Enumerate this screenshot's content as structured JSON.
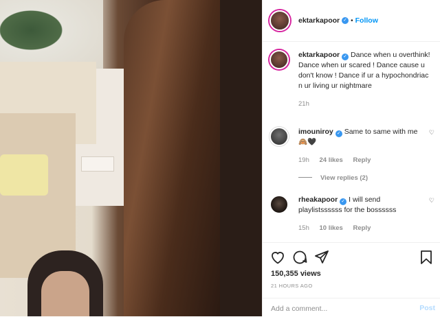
{
  "header": {
    "username": "ektarkapoor",
    "separator": "•",
    "follow_label": "Follow"
  },
  "caption": {
    "username": "ektarkapoor",
    "text": "Dance when u overthink! Dance when ur scared ! Dance cause u don't know ! Dance if ur a hypochondriac n ur living ur nightmare",
    "time": "21h"
  },
  "comments": [
    {
      "username": "imouniroy",
      "text": "Same to same with me🙈🖤",
      "time": "19h",
      "likes": "24 likes",
      "reply_label": "Reply"
    },
    {
      "username": "rheakapoor",
      "text": "I will send playlistssssss for the bossssss",
      "time": "15h",
      "likes": "10 likes",
      "reply_label": "Reply"
    }
  ],
  "view_replies_label": "View replies (2)",
  "stats": {
    "views": "150,355 views",
    "timestamp": "21 HOURS AGO"
  },
  "add_comment": {
    "placeholder": "Add a comment...",
    "post_label": "Post"
  },
  "icons": {
    "like": "heart-icon",
    "comment": "comment-icon",
    "share": "paper-plane-icon",
    "save": "bookmark-icon",
    "verified": "verified-badge-icon"
  },
  "colors": {
    "accent": "#0095f6",
    "post_disabled": "#b3dbff",
    "muted": "#8e8e8e",
    "text": "#262626"
  }
}
